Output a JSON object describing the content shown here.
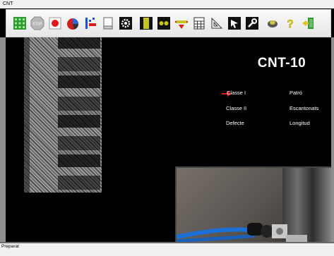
{
  "window": {
    "title": "CNT"
  },
  "toolbar": {
    "buttons": [
      {
        "icon": "grid-capture-icon"
      },
      {
        "icon": "stop-icon",
        "label": "STOP"
      },
      {
        "icon": "record-icon"
      },
      {
        "icon": "pie-chart-icon"
      },
      {
        "icon": "bar-level-icon"
      },
      {
        "icon": "document-icon"
      },
      {
        "icon": "settings-gear-icon"
      },
      {
        "icon": "single-view-icon"
      },
      {
        "icon": "dual-view-icon"
      },
      {
        "icon": "arrow-select-icon"
      },
      {
        "icon": "calculator-icon"
      },
      {
        "icon": "set-square-icon"
      },
      {
        "icon": "cursor-icon"
      },
      {
        "icon": "wrench-icon"
      },
      {
        "icon": "plugin-icon"
      },
      {
        "icon": "help-icon"
      },
      {
        "icon": "exit-door-icon"
      }
    ]
  },
  "main": {
    "model_title": "CNT-10",
    "menu": {
      "classe_1": "Classe I",
      "patro": "Patró",
      "classe_2": "Classe II",
      "escantonats": "Escantonats",
      "defecte": "Defecte",
      "longitud": "Longitud"
    }
  },
  "status": {
    "text": "Preparat"
  },
  "colors": {
    "arrow": "#e02020",
    "toolbar_bg": "#eeeeee",
    "main_bg": "#000000"
  }
}
